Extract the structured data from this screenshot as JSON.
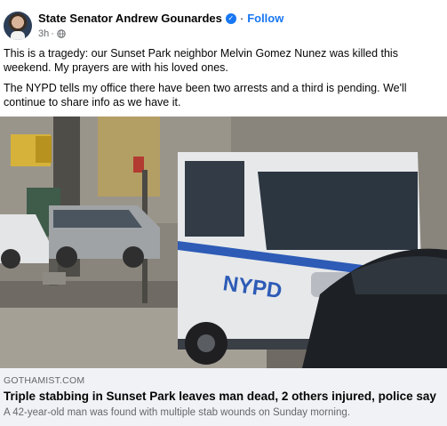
{
  "post": {
    "author": "State Senator Andrew Gounardes",
    "verified_icon": "verified-badge-icon",
    "separator": "·",
    "follow_label": "Follow",
    "timestamp": "3h",
    "meta_separator": "·",
    "audience_icon": "globe-icon",
    "paragraph_1": "This is a tragedy: our Sunset Park neighbor Melvin Gomez Nunez was killed this weekend. My prayers are with his loved ones.",
    "paragraph_2": "The NYPD tells my office there have been two arrests and a third is pending. We'll continue to share info as we have it."
  },
  "link_preview": {
    "van_text": "NYPD",
    "domain": "GOTHAMIST.COM",
    "title": "Triple stabbing in Sunset Park leaves man dead, 2 others injured, police say",
    "description": "A 42-year-old man was found with multiple stab wounds on Sunday morning."
  },
  "colors": {
    "accent": "#1877f2",
    "secondary_text": "#65676b",
    "preview_background": "#f0f2f5"
  }
}
